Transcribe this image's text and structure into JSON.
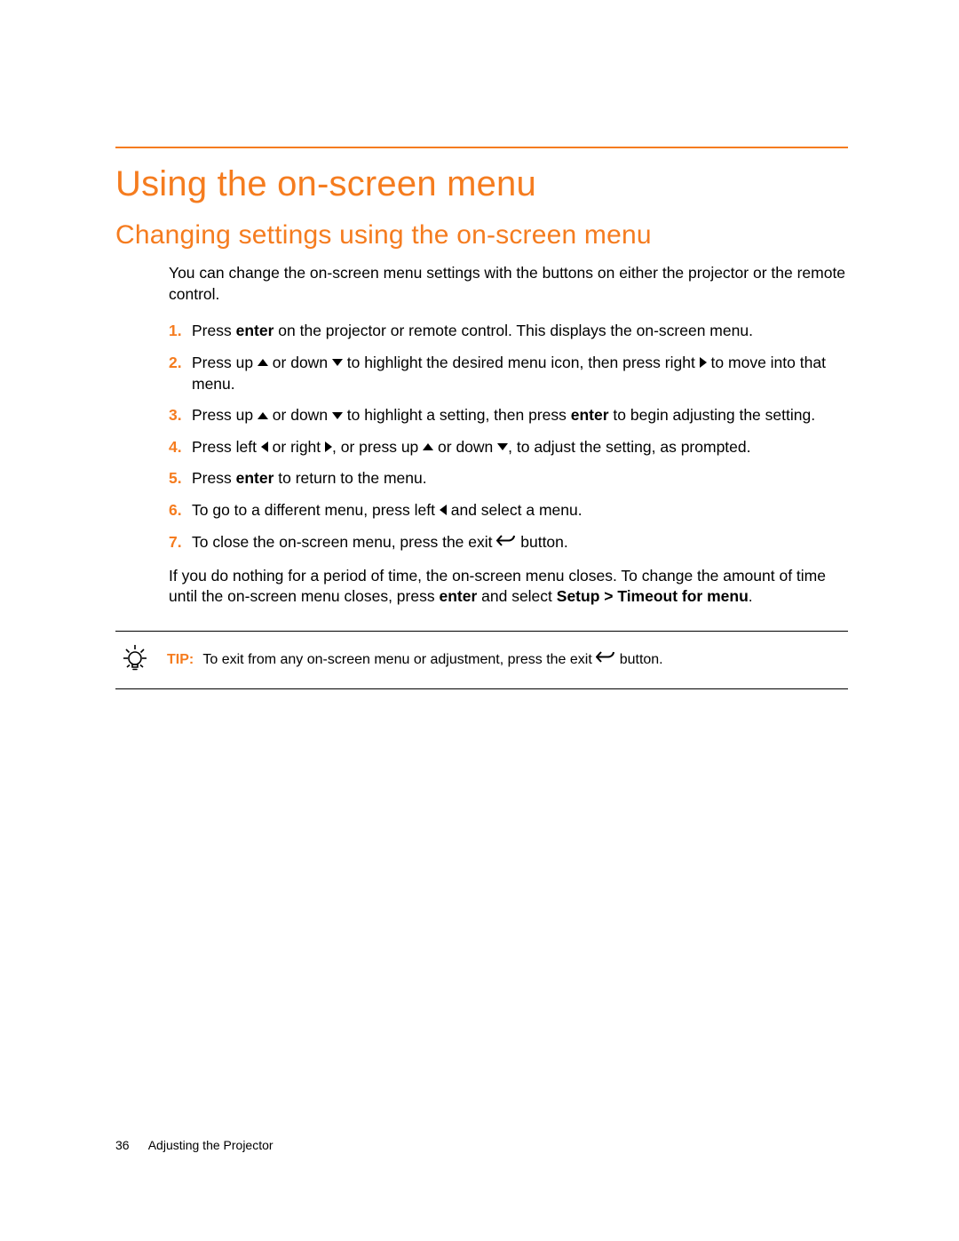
{
  "heading1": "Using the on-screen menu",
  "heading2": "Changing settings using the on-screen menu",
  "intro": "You can change the on-screen menu settings with the buttons on either the projector or the remote control.",
  "steps": {
    "n1": "1.",
    "n2": "2.",
    "n3": "3.",
    "n4": "4.",
    "n5": "5.",
    "n6": "6.",
    "n7": "7.",
    "s1a": "Press ",
    "s1b": "enter",
    "s1c": " on the projector or remote control. This displays the on-screen menu.",
    "s2a": "Press up ",
    "s2b": " or down ",
    "s2c": " to highlight the desired menu icon, then press right ",
    "s2d": " to move into that menu.",
    "s3a": "Press up ",
    "s3b": " or down ",
    "s3c": " to highlight a setting, then press ",
    "s3d": "enter",
    "s3e": " to begin adjusting the setting.",
    "s4a": "Press left ",
    "s4b": " or right ",
    "s4c": ", or press up ",
    "s4d": " or down ",
    "s4e": ", to adjust the setting, as prompted.",
    "s5a": "Press ",
    "s5b": "enter",
    "s5c": " to return to the menu.",
    "s6a": "To go to a different menu, press left ",
    "s6b": " and select a menu.",
    "s7a": "To close the on-screen menu, press the exit ",
    "s7b": " button."
  },
  "closing_a": "If you do nothing for a period of time, the on-screen menu closes. To change the amount of time until the on-screen menu closes, press ",
  "closing_b": "enter",
  "closing_c": " and select ",
  "closing_d": "Setup > Timeout for menu",
  "closing_e": ".",
  "tip_label": "TIP:",
  "tip_a": "To exit from any on-screen menu or adjustment, press the exit ",
  "tip_b": " button.",
  "footer": {
    "page": "36",
    "section": "Adjusting the Projector"
  }
}
